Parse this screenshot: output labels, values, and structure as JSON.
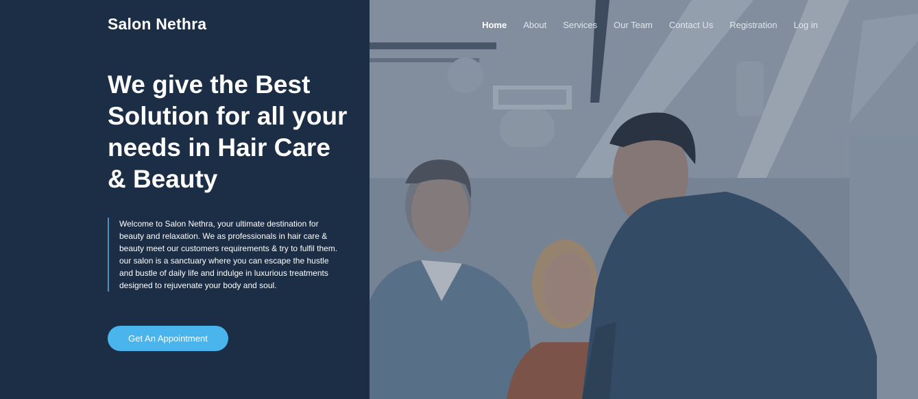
{
  "brand": {
    "name": "Salon Nethra"
  },
  "nav": {
    "items": [
      {
        "label": "Home",
        "active": true
      },
      {
        "label": "About"
      },
      {
        "label": "Services"
      },
      {
        "label": "Our Team"
      },
      {
        "label": "Contact Us"
      },
      {
        "label": "Registration"
      },
      {
        "label": "Log in"
      }
    ]
  },
  "hero": {
    "headline": "We give the Best Solution for all your needs in Hair Care & Beauty",
    "intro": "Welcome to Salon Nethra, your ultimate destination for beauty and relaxation. We as professionals in hair care & beauty meet our customers requirements & try to fulfil them. our salon is a sanctuary where you can escape the hustle and bustle of daily life and indulge in luxurious treatments designed to rejuvenate your body and soul.",
    "cta_label": "Get An Appointment"
  },
  "colors": {
    "panel": "#1c2e45",
    "accent": "#4ab5ec",
    "quote_border": "#4e8fc4"
  }
}
